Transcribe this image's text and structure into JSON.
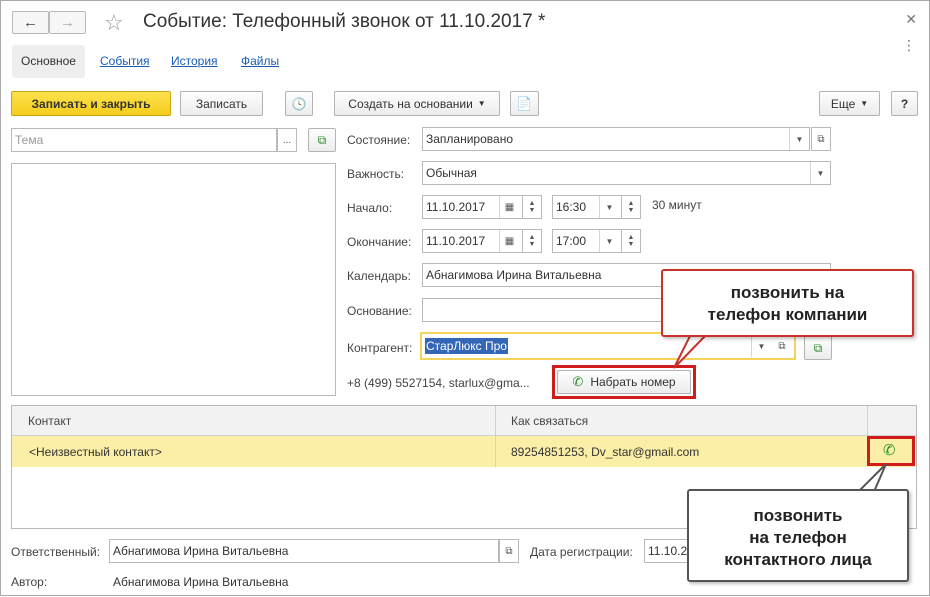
{
  "window": {
    "title": "Событие: Телефонный звонок от 11.10.2017 *"
  },
  "tabs": [
    {
      "label": "Основное"
    },
    {
      "label": "События"
    },
    {
      "label": "История"
    },
    {
      "label": "Файлы"
    }
  ],
  "toolbar": {
    "save_close": "Записать и закрыть",
    "save": "Записать",
    "create_based": "Создать на основании",
    "more": "Еще",
    "help": "?"
  },
  "form": {
    "subject_placeholder": "Тема",
    "state_label": "Состояние:",
    "state_value": "Запланировано",
    "importance_label": "Важность:",
    "importance_value": "Обычная",
    "start_label": "Начало:",
    "start_date": "11.10.2017",
    "start_time": "16:30",
    "duration": "30 минут",
    "end_label": "Окончание:",
    "end_date": "11.10.2017",
    "end_time": "17:00",
    "calendar_label": "Календарь:",
    "calendar_value": "Абнагимова Ирина Витальевна",
    "basis_label": "Основание:",
    "basis_value": "",
    "counterparty_label": "Контрагент:",
    "counterparty_value": "СтарЛюкс Про",
    "contact_info": "+8 (499) 5527154, starlux@gma...",
    "dial_button": "Набрать номер"
  },
  "contacts_table": {
    "columns": [
      "Контакт",
      "Как связаться"
    ],
    "rows": [
      {
        "contact": "<Неизвестный контакт>",
        "how": "89254851253, Dv_star@gmail.com"
      }
    ]
  },
  "footer": {
    "responsible_label": "Ответственный:",
    "responsible_value": "Абнагимова Ирина Витальевна",
    "reg_date_label": "Дата регистрации:",
    "reg_date_value": "11.10.2...",
    "author_label": "Автор:",
    "author_value": "Абнагимова Ирина Витальевна"
  },
  "callouts": {
    "company": "позвонить на\nтелефон компании",
    "contact": "позвонить\nна телефон\nконтактного лица"
  },
  "colors": {
    "primary_button": "#f5cd1b",
    "selected_row": "#fbeea6",
    "highlight_border": "#d11c1c",
    "link": "#1b5cb5"
  }
}
